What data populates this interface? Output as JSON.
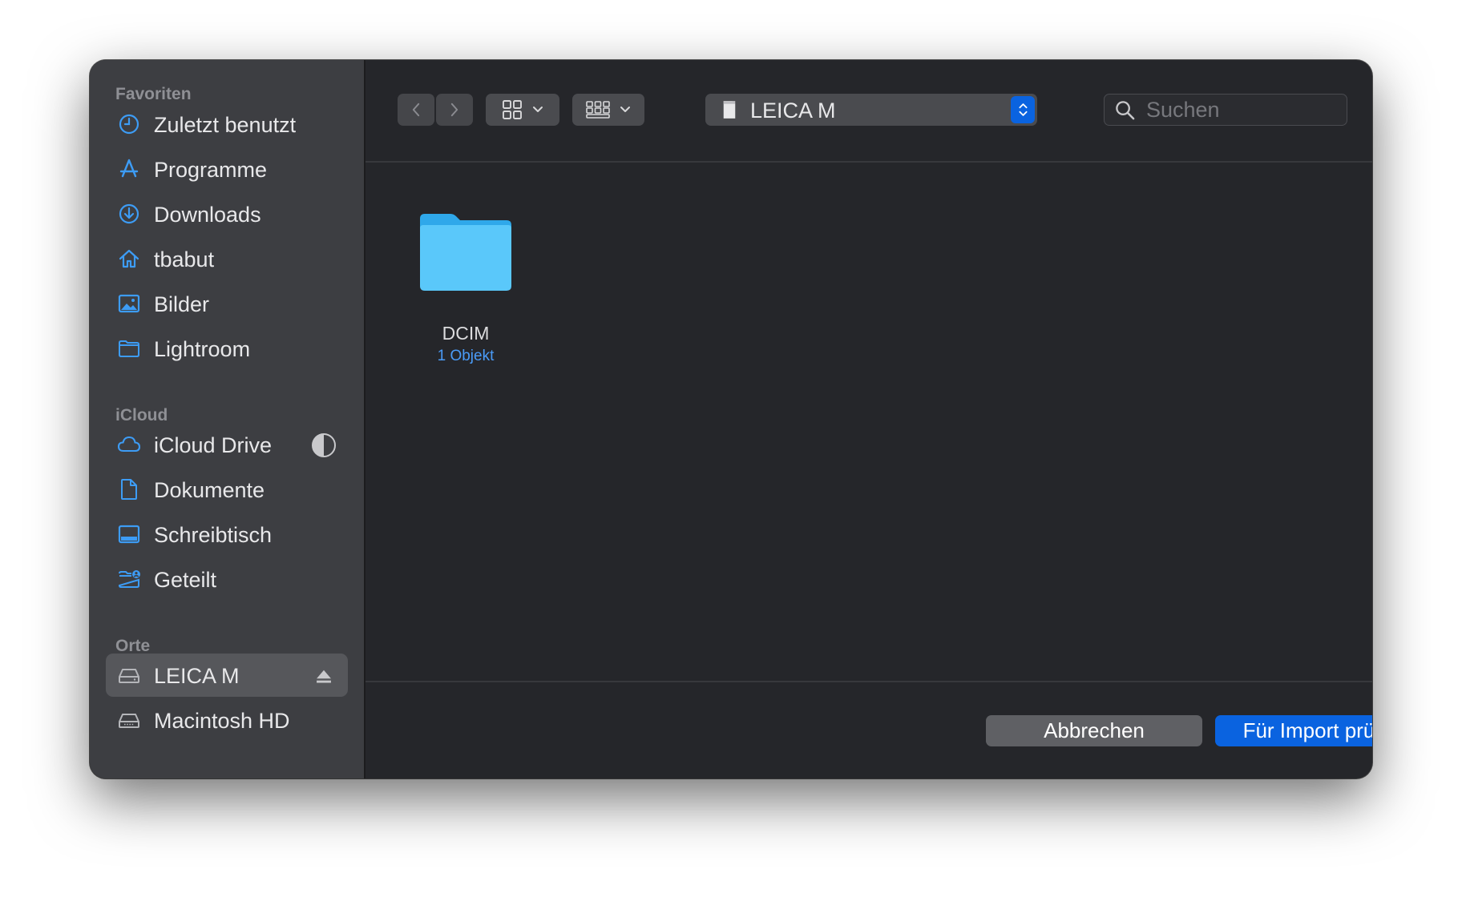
{
  "sidebar": {
    "sections": [
      {
        "title": "Favoriten",
        "items": [
          {
            "label": "Zuletzt benutzt",
            "icon": "clock-icon"
          },
          {
            "label": "Programme",
            "icon": "apps-icon"
          },
          {
            "label": "Downloads",
            "icon": "download-icon"
          },
          {
            "label": "tbabut",
            "icon": "home-icon"
          },
          {
            "label": "Bilder",
            "icon": "photo-icon"
          },
          {
            "label": "Lightroom",
            "icon": "folder-icon"
          }
        ]
      },
      {
        "title": "iCloud",
        "items": [
          {
            "label": "iCloud Drive",
            "icon": "cloud-icon"
          },
          {
            "label": "Dokumente",
            "icon": "document-icon"
          },
          {
            "label": "Schreibtisch",
            "icon": "desktop-icon"
          },
          {
            "label": "Geteilt",
            "icon": "shared-folder-icon"
          }
        ]
      },
      {
        "title": "Orte",
        "items": [
          {
            "label": "LEICA M",
            "icon": "drive-icon",
            "selected": true
          },
          {
            "label": "Macintosh HD",
            "icon": "hard-drive-icon"
          }
        ]
      }
    ]
  },
  "toolbar": {
    "path_label": "LEICA M",
    "search_placeholder": "Suchen"
  },
  "files": [
    {
      "name": "DCIM",
      "meta": "1 Objekt",
      "icon": "folder-icon"
    }
  ],
  "footer": {
    "cancel_label": "Abbrechen",
    "primary_label": "Für Import prüfen"
  },
  "colors": {
    "accent": "#0a63e0",
    "sidebar_icon": "#3d9cf5",
    "folder": "#5ac8fa",
    "window_bg": "#25262a",
    "sidebar_bg": "#3d3e42"
  }
}
